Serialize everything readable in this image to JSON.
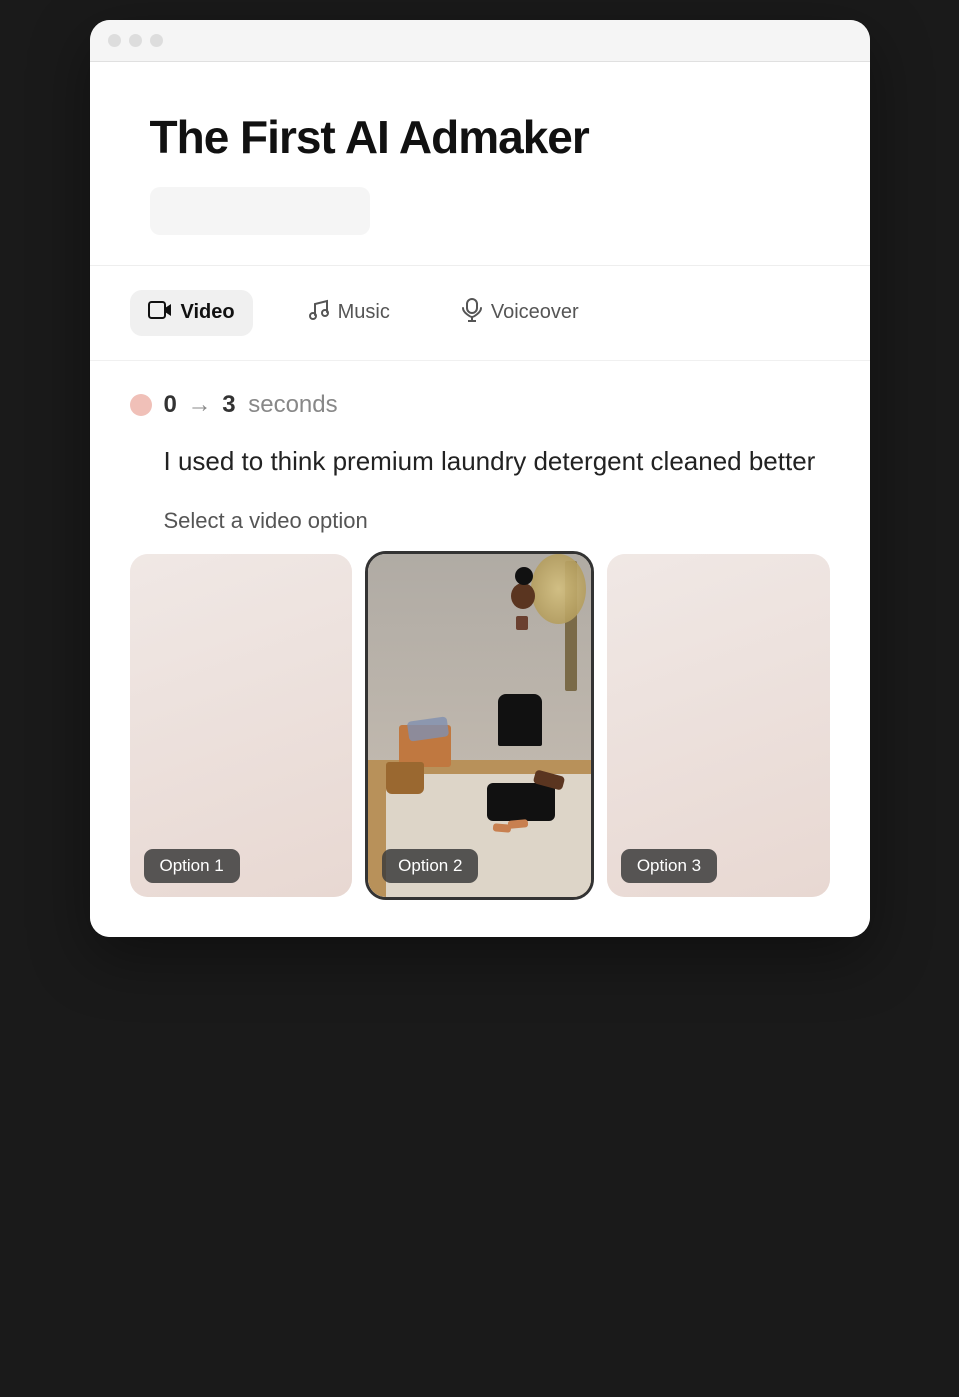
{
  "browser": {
    "dots": [
      "dot1",
      "dot2",
      "dot3"
    ]
  },
  "header": {
    "title": "The First AI Admaker"
  },
  "tabs": [
    {
      "id": "video",
      "label": "Video",
      "icon": "🎬",
      "active": true
    },
    {
      "id": "music",
      "label": "Music",
      "icon": "♫",
      "active": false
    },
    {
      "id": "voiceover",
      "label": "Voiceover",
      "icon": "🎤",
      "active": false
    }
  ],
  "scene": {
    "timeline_start": "0",
    "timeline_arrow": "→",
    "timeline_end": "3",
    "timeline_unit": "seconds",
    "scene_text": "I used to think premium laundry detergent cleaned better",
    "select_label": "Select a video option"
  },
  "options": [
    {
      "id": "option1",
      "label": "Option 1",
      "active": false
    },
    {
      "id": "option2",
      "label": "Option 2",
      "active": true
    },
    {
      "id": "option3",
      "label": "Option 3",
      "active": false
    }
  ]
}
